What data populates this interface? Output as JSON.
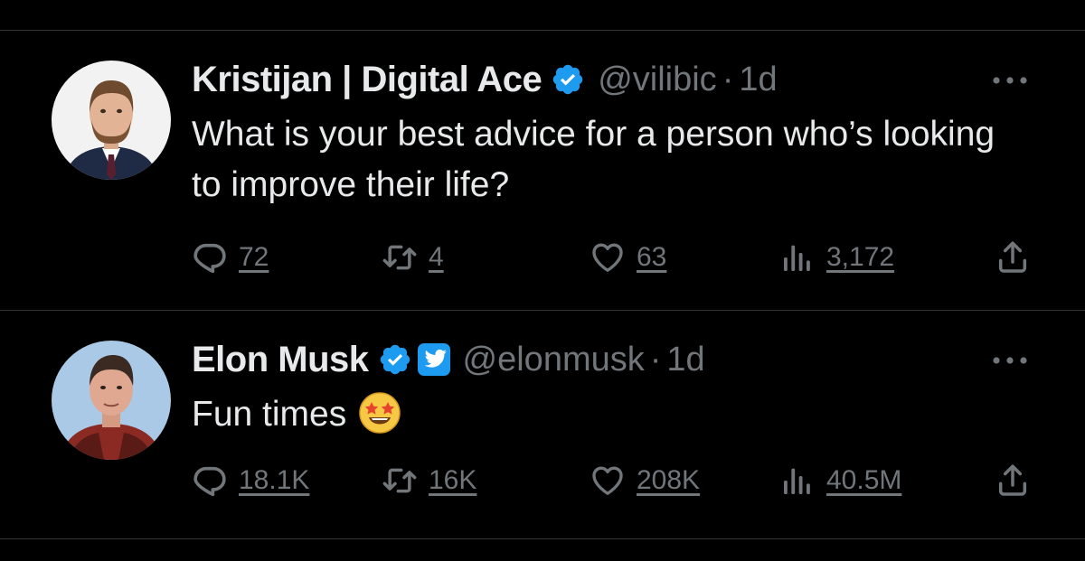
{
  "tweets": [
    {
      "author_name": "Kristijan | Digital Ace",
      "handle": "@vilibic",
      "separator": "·",
      "time": "1d",
      "verified": true,
      "affiliate_badge": false,
      "text": "What is your best advice for a person who’s looking to improve their life?",
      "replies": "72",
      "retweets": "4",
      "likes": "63",
      "views": "3,172"
    },
    {
      "author_name": "Elon Musk",
      "handle": "@elonmusk",
      "separator": "·",
      "time": "1d",
      "verified": true,
      "affiliate_badge": "twitter-bird-icon",
      "text": "Fun times",
      "emoji": "star-struck-emoji",
      "replies": "18.1K",
      "retweets": "16K",
      "likes": "208K",
      "views": "40.5M"
    }
  ],
  "icons": [
    "reply-icon",
    "retweet-icon",
    "like-icon",
    "views-icon",
    "share-icon",
    "more-icon",
    "verified-badge-icon"
  ],
  "colors": {
    "background": "#000000",
    "text": "#e7e9ea",
    "secondary": "#71767b",
    "accent": "#1d9bf0",
    "divider": "#2f3336"
  }
}
